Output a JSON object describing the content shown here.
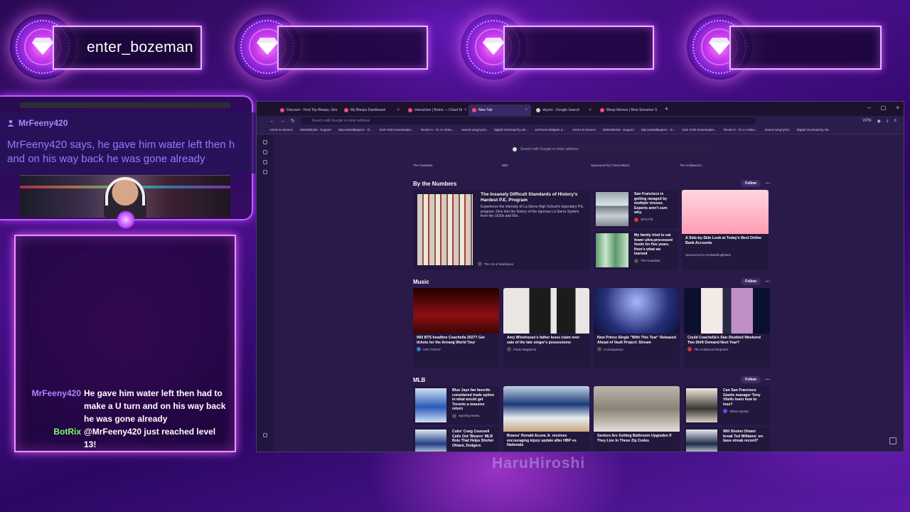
{
  "overlay": {
    "plates": [
      {
        "name": "enter_bozeman"
      },
      {
        "name": ""
      },
      {
        "name": ""
      },
      {
        "name": ""
      }
    ],
    "chat_highlight": {
      "user": "MrFeeny420",
      "message": "MrFeeny420 says, he gave him water left then h",
      "message2": "and on his way back he was gone already"
    },
    "chat": [
      {
        "user": "MrFeeny420",
        "user_color": "#b184ff",
        "text": "He gave him water left then had to make a U turn and on his way back he was gone already"
      },
      {
        "user": "BotRix",
        "user_color": "#7dff6a",
        "text": "@MrFeeny420 just reached level 13!"
      }
    ],
    "watermark": "HaruHiroshi"
  },
  "browser": {
    "tabs": [
      {
        "label": "Discover - Find Top Bleeps, Stre",
        "color": "#ff4a6a",
        "active": false
      },
      {
        "label": "My Bleeps Dashboard",
        "color": "#ff4a6a",
        "active": false
      },
      {
        "label": "Interaction | Botrix — Cloud St",
        "color": "#ff4a6a",
        "active": false
      },
      {
        "label": "New Tab",
        "color": "#ff4a6a",
        "active": true
      },
      {
        "label": "skynet - Google Search",
        "color": "#cfcfcf",
        "active": false
      },
      {
        "label": "Bleep Memes | Best Streamer S",
        "color": "#ff4a6a",
        "active": false
      }
    ],
    "address_placeholder": "Search with Google or enter address",
    "vpn_label": "VPN",
    "bookmarks": [
      "ASUS E-Service",
      "IDE5SBU65 - Support",
      "MyLiveWallpapers - D...",
      "Kick VOD Downloader...",
      "Revid AI - #1 AI Video...",
      "Saved song lyrics",
      "Digital Overload by Sk...",
      "ExtTools Widgets a...",
      "ASUS E-Service",
      "IDE5SBU65 - Support",
      "MyLiveWallpapers - D...",
      "Kick VOD Downloader...",
      "Revid AI - #1 AI Video...",
      "Saved song lyrics",
      "Digital Overload by Sk..."
    ],
    "search_placeholder": "Search with Google or enter address",
    "top_sources": [
      "The Guardian",
      "BBC",
      "Sponsored by FinanceBuzz",
      "The Hollywood..."
    ],
    "sections": [
      {
        "title": "By the Numbers",
        "follow": "Follow",
        "feature": {
          "title": "The Insanely Difficult Standards of History's Hardest P.E. Program",
          "desc": "Experience the intensity of La Sierra High School's legendary P.E. program. Dive into the history of the rigorous La Sierra System from the 1930s and 60s.",
          "source": "The Art of Manliness"
        },
        "small": [
          {
            "title": "San Francisco is getting ravaged by multiple viruses. Experts aren't sure why.",
            "source": "SFGATE"
          },
          {
            "title": "My family tried to eat fewer ultra-processed foods for five years. Here's what we learned",
            "source": "The Guardian"
          }
        ],
        "ad": {
          "title": "A Side-by-Side Look at Today's Best Online Bank Accounts",
          "source": "Sponsored by GOBankingRates"
        }
      },
      {
        "title": "Music",
        "follow": "Follow",
        "cards": [
          {
            "title": "Will BTS headline Coachella 2027? Get tickets for the Arirang World Tour",
            "source": "USA TODAY"
          },
          {
            "title": "Amy Winehouse's father loses claim over sale of the late singer's possessions",
            "source": "Paste Magazine"
          },
          {
            "title": "New Prince Single \"With This Tear\" Released Ahead of Vault Project: Stream",
            "source": "Consequence"
          },
          {
            "title": "Could Coachella's Star-Studded Weekend Two Shift Demand Next Year?",
            "source": "The Hollywood Reporter"
          }
        ]
      },
      {
        "title": "MLB",
        "follow": "Follow",
        "small_left": [
          {
            "title": "Blue Jays fan favorite considered trade option in what would get Toronto a massive return",
            "source": "Sporting News"
          },
          {
            "title": "Cubs' Craig Counsell Calls Out 'Bizarre' MLB Rule That Helps Shohei Ohtani, Dodgers",
            "source": ""
          }
        ],
        "cards": [
          {
            "title": "Braves' Ronald Acuna Jr. receives encouraging injury update after HBP vs. Nationals",
            "source": ""
          },
          {
            "title": "Seniors Are Getting Bathroom Upgrades If They Live In These Zip Codes",
            "source": ""
          }
        ],
        "small_right": [
          {
            "title": "Can San Francisco Giants manager Tony Vitello learn how to lose?",
            "source": "Yahoo Sports"
          },
          {
            "title": "Will Shohei Ohtani break Ted Williams' on-base streak record?",
            "source": ""
          }
        ]
      }
    ]
  }
}
